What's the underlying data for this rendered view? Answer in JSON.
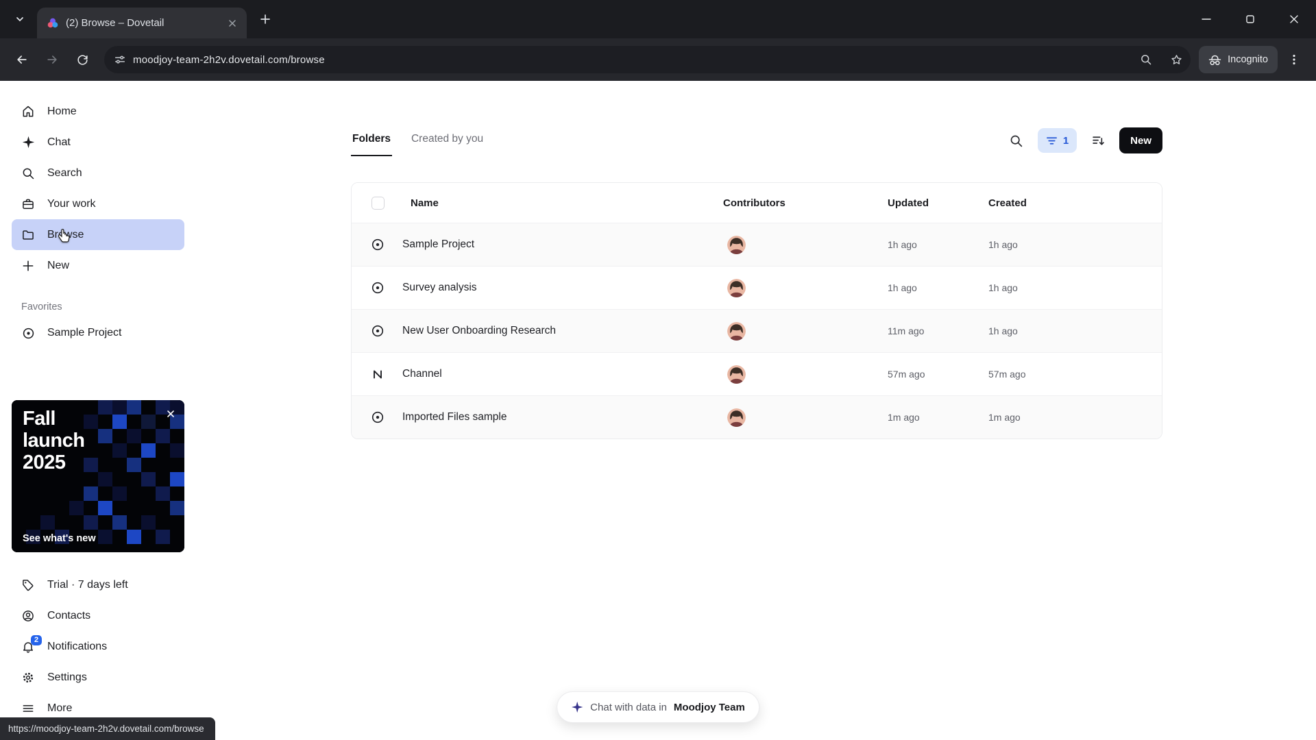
{
  "browser": {
    "tab_title": "(2) Browse – Dovetail",
    "url": "moodjoy-team-2h2v.dovetail.com/browse",
    "incognito_label": "Incognito",
    "status_url": "https://moodjoy-team-2h2v.dovetail.com/browse"
  },
  "sidebar": {
    "items": [
      {
        "label": "Home",
        "icon": "home-icon"
      },
      {
        "label": "Chat",
        "icon": "sparkle-icon"
      },
      {
        "label": "Search",
        "icon": "search-icon"
      },
      {
        "label": "Your work",
        "icon": "briefcase-icon"
      },
      {
        "label": "Browse",
        "icon": "folder-icon",
        "selected": true
      },
      {
        "label": "New",
        "icon": "plus-icon"
      }
    ],
    "favorites_label": "Favorites",
    "favorites": [
      {
        "label": "Sample Project",
        "icon": "target-icon"
      }
    ],
    "promo": {
      "title": "Fall\nlaunch\n2025",
      "cta": "See what's new"
    },
    "footer_items": [
      {
        "label": "Trial · 7 days left",
        "icon": "tag-icon"
      },
      {
        "label": "Contacts",
        "icon": "person-icon"
      },
      {
        "label": "Notifications",
        "icon": "bell-icon",
        "badge": "2"
      },
      {
        "label": "Settings",
        "icon": "gear-icon"
      },
      {
        "label": "More",
        "icon": "menu-icon"
      }
    ]
  },
  "main": {
    "tabs": [
      {
        "label": "Folders",
        "active": true
      },
      {
        "label": "Created by you",
        "active": false
      }
    ],
    "filter_count": "1",
    "new_button": "New",
    "table": {
      "columns": [
        "Name",
        "Contributors",
        "Updated",
        "Created"
      ],
      "rows": [
        {
          "name": "Sample Project",
          "icon": "target",
          "updated": "1h ago",
          "created": "1h ago"
        },
        {
          "name": "Survey analysis",
          "icon": "target",
          "updated": "1h ago",
          "created": "1h ago"
        },
        {
          "name": "New User Onboarding Research",
          "icon": "target",
          "updated": "11m ago",
          "created": "1h ago"
        },
        {
          "name": "Channel",
          "icon": "channel",
          "updated": "57m ago",
          "created": "57m ago"
        },
        {
          "name": "Imported Files sample",
          "icon": "target",
          "updated": "1m ago",
          "created": "1m ago"
        }
      ]
    },
    "chat_pill": {
      "prefix": "Chat with data in",
      "team": "Moodjoy Team"
    }
  },
  "colors": {
    "accent_blue": "#2563eb",
    "selected_item_bg": "#c7d2f8",
    "new_button_bg": "#0d0e12",
    "promo_bg": "#000000",
    "badge_bg": "#2563eb"
  }
}
